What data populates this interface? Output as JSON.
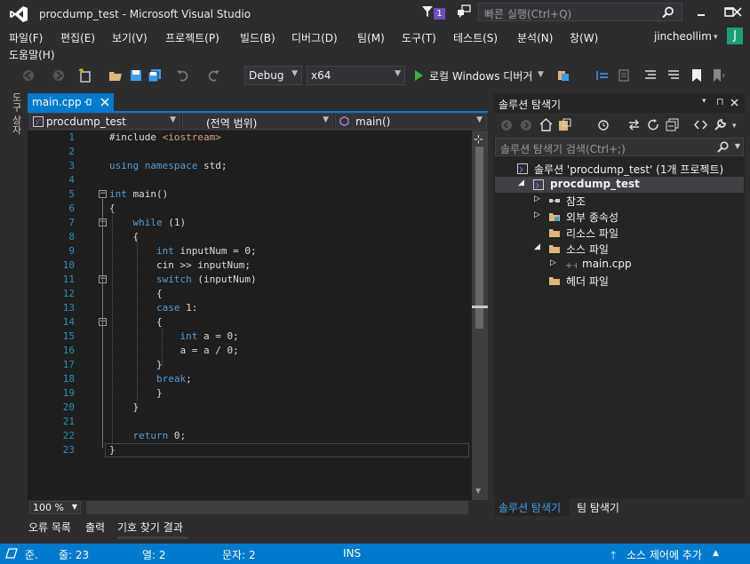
{
  "window": {
    "title": "procdump_test - Microsoft Visual Studio",
    "notification_count": "1",
    "quick_launch_placeholder": "빠른 실행(Ctrl+Q)"
  },
  "menu": {
    "items": [
      "파일(F)",
      "편집(E)",
      "보기(V)",
      "프로젝트(P)",
      "빌드(B)",
      "디버그(D)",
      "팀(M)",
      "도구(T)",
      "테스트(S)",
      "분석(N)",
      "창(W)",
      "도움말(H)"
    ],
    "user": "jincheollim",
    "avatar_letter": "J"
  },
  "toolbar": {
    "config": "Debug",
    "platform": "x64",
    "debugger": "로컬 Windows 디버거"
  },
  "left_strip": {
    "label": "도구 상자"
  },
  "editor": {
    "tab_label": "main.cpp",
    "nav_project": "procdump_test",
    "nav_scope": "(전역 범위)",
    "nav_member": "main()",
    "zoom": "100 %",
    "lines": [
      {
        "n": "1",
        "parts": [
          [
            "#include ",
            ""
          ],
          [
            "<iostream>",
            "str"
          ]
        ]
      },
      {
        "n": "2",
        "parts": []
      },
      {
        "n": "3",
        "parts": [
          [
            "using",
            "kw"
          ],
          [
            " ",
            ""
          ],
          [
            "namespace",
            "kw"
          ],
          [
            " std;",
            ""
          ]
        ]
      },
      {
        "n": "4",
        "parts": []
      },
      {
        "n": "5",
        "parts": [
          [
            "int",
            "kw"
          ],
          [
            " main()",
            ""
          ]
        ]
      },
      {
        "n": "6",
        "parts": [
          [
            "{",
            ""
          ]
        ]
      },
      {
        "n": "7",
        "parts": [
          [
            "    ",
            ""
          ],
          [
            "while",
            "kw"
          ],
          [
            " (1)",
            ""
          ]
        ]
      },
      {
        "n": "8",
        "parts": [
          [
            "    {",
            ""
          ]
        ]
      },
      {
        "n": "9",
        "parts": [
          [
            "        ",
            ""
          ],
          [
            "int",
            "kw"
          ],
          [
            " inputNum = 0;",
            ""
          ]
        ]
      },
      {
        "n": "10",
        "parts": [
          [
            "        cin >> inputNum;",
            ""
          ]
        ]
      },
      {
        "n": "11",
        "parts": [
          [
            "        ",
            ""
          ],
          [
            "switch",
            "kw"
          ],
          [
            " (inputNum)",
            ""
          ]
        ]
      },
      {
        "n": "12",
        "parts": [
          [
            "        {",
            ""
          ]
        ]
      },
      {
        "n": "13",
        "parts": [
          [
            "        ",
            ""
          ],
          [
            "case",
            "kw"
          ],
          [
            " 1:",
            ""
          ]
        ]
      },
      {
        "n": "14",
        "parts": [
          [
            "        {",
            ""
          ]
        ]
      },
      {
        "n": "15",
        "parts": [
          [
            "            ",
            ""
          ],
          [
            "int",
            "kw"
          ],
          [
            " a = 0;",
            ""
          ]
        ]
      },
      {
        "n": "16",
        "parts": [
          [
            "            a = a / 0;",
            ""
          ]
        ]
      },
      {
        "n": "17",
        "parts": [
          [
            "        }",
            ""
          ]
        ]
      },
      {
        "n": "18",
        "parts": [
          [
            "        ",
            ""
          ],
          [
            "break",
            "kw"
          ],
          [
            ";",
            ""
          ]
        ]
      },
      {
        "n": "19",
        "parts": [
          [
            "        }",
            ""
          ]
        ]
      },
      {
        "n": "20",
        "parts": [
          [
            "    }",
            ""
          ]
        ]
      },
      {
        "n": "21",
        "parts": []
      },
      {
        "n": "22",
        "parts": [
          [
            "    ",
            ""
          ],
          [
            "return",
            "kw"
          ],
          [
            " 0;",
            ""
          ]
        ]
      },
      {
        "n": "23",
        "parts": [
          [
            "}",
            ""
          ]
        ]
      }
    ]
  },
  "solution_explorer": {
    "title": "솔루션 탐색기",
    "search_placeholder": "솔루션 탐색기 검색(Ctrl+;)",
    "tree": [
      {
        "label": "솔루션 'procdump_test' (1개 프로젝트)",
        "icon": "solution-icon",
        "expander": ""
      },
      {
        "label": "procdump_test",
        "icon": "cpp-project-icon",
        "expander": "◢",
        "bold": true
      },
      {
        "label": "참조",
        "icon": "references-icon",
        "expander": "▷"
      },
      {
        "label": "외부 종속성",
        "icon": "external-deps-icon",
        "expander": "▷"
      },
      {
        "label": "리소스 파일",
        "icon": "folder-icon",
        "expander": ""
      },
      {
        "label": "소스 파일",
        "icon": "folder-open-icon",
        "expander": "◢"
      },
      {
        "label": "main.cpp",
        "icon": "cpp-file-icon",
        "expander": "▷"
      },
      {
        "label": "헤더 파일",
        "icon": "folder-icon",
        "expander": ""
      }
    ],
    "tab_active": "솔루션 탐색기",
    "tab_other": "팀 탐색기"
  },
  "bottom_tabs": [
    "오류 목록",
    "출력",
    "기호 찾기 결과"
  ],
  "status": {
    "ready": "준.",
    "line": "줄: 23",
    "col": "열: 2",
    "char": "문자: 2",
    "mode": "INS",
    "source_control": "소스 제어에 추가"
  },
  "colors": {
    "accent": "#007acc",
    "keyword": "#569cd6",
    "string": "#d69d85",
    "line_number": "#2b91af",
    "editor_bg": "#1e1e1e"
  }
}
